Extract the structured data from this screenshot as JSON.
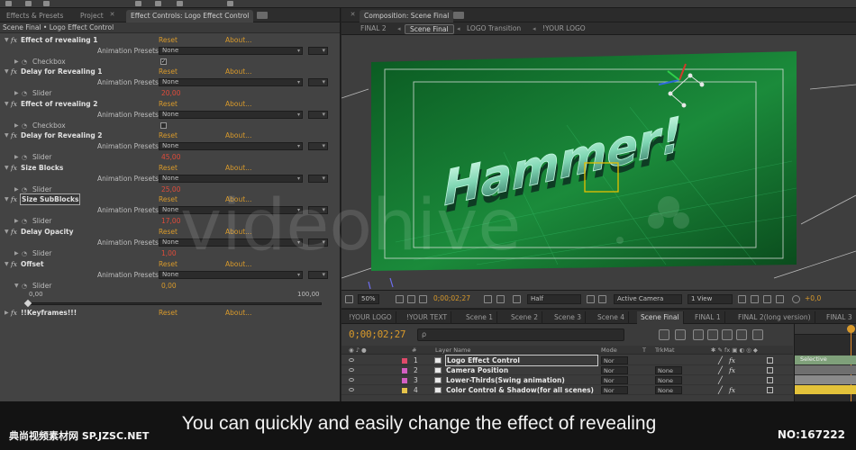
{
  "left_panel": {
    "tabs": [
      "Effects & Presets",
      "Project",
      "Effect Controls: Logo Effect Control"
    ],
    "breadcrumb": "Scene Final • Logo Effect Control",
    "reset_label": "Reset",
    "about_label": "About...",
    "animation_presets_label": "Animation Presets:",
    "preset_value": "None",
    "checkbox_label": "Checkbox",
    "slider_label": "Slider",
    "effects": [
      {
        "name": "Effect of revealing 1",
        "param": "Checkbox",
        "value": "✓"
      },
      {
        "name": "Delay for Revealing 1",
        "param": "Slider",
        "value": "20,00"
      },
      {
        "name": "Effect of revealing 2",
        "param": "Checkbox",
        "value": ""
      },
      {
        "name": "Delay for Revealing 2",
        "param": "Slider",
        "value": "45,00"
      },
      {
        "name": "Size Blocks",
        "param": "Slider",
        "value": "25,00"
      },
      {
        "name": "Size SubBlocks",
        "param": "Slider",
        "value": "17,00"
      },
      {
        "name": "Delay Opacity",
        "param": "Slider",
        "value": "1,00"
      },
      {
        "name": "Offset",
        "param": "Slider",
        "value": "0,00"
      }
    ],
    "offset_slider": {
      "min_label": "0,00",
      "max_label": "100,00",
      "fraction": 0.0
    },
    "keyframes_label": "!!Keyframes!!!"
  },
  "comp_panel": {
    "title": "Composition: Scene Final",
    "breadcrumbs": [
      "FINAL 2",
      "Scene Final",
      "LOGO Transition",
      "!YOUR LOGO"
    ],
    "active_breadcrumb_index": 1,
    "zoom": "50%",
    "timecode": "0;00;02;27",
    "resolution": "Half",
    "camera": "Active Camera",
    "views": "1 View",
    "exposure": "+0,0",
    "scene_text": "Hammer!",
    "accent_green": "#1f8a3a",
    "box_yellow": "#e6c000"
  },
  "timeline": {
    "tabs": [
      "!YOUR LOGO",
      "!YOUR TEXT",
      "Scene 1",
      "Scene 2",
      "Scene 3",
      "Scene 4",
      "Scene Final",
      "FINAL 1",
      "FINAL 2(long version)",
      "FINAL 3"
    ],
    "active_tab_index": 6,
    "timecode": "0;00;02;27",
    "search_placeholder": "ρ",
    "columns": {
      "num": "#",
      "layer_name": "Layer Name",
      "mode": "Mode",
      "t": "T",
      "trkmat": "TrkMat"
    },
    "layers": [
      {
        "num": "1",
        "name": "Logo Effect Control",
        "mode": "Nor",
        "trkmat": "",
        "label_color": "#e04a6a",
        "selected": true
      },
      {
        "num": "2",
        "name": "Camera Position",
        "mode": "Nor",
        "trkmat": "None",
        "label_color": "#d45fc3",
        "selected": false
      },
      {
        "num": "3",
        "name": "Lower-Thirds(Swing animation)",
        "mode": "Nor",
        "trkmat": "None",
        "label_color": "#d45fc3",
        "selected": false
      },
      {
        "num": "4",
        "name": "Color Control & Shadow(for all scenes)",
        "mode": "Nor",
        "trkmat": "None",
        "label_color": "#e6c34a",
        "selected": false
      }
    ],
    "graph_label": "Selective"
  },
  "overlay": {
    "caption": "You can quickly and easily change the effect of revealing",
    "site_label": "典尚视频素材网 SP.JZSC.NET",
    "id_label": "NO:167222",
    "watermark_text": "videohive"
  }
}
